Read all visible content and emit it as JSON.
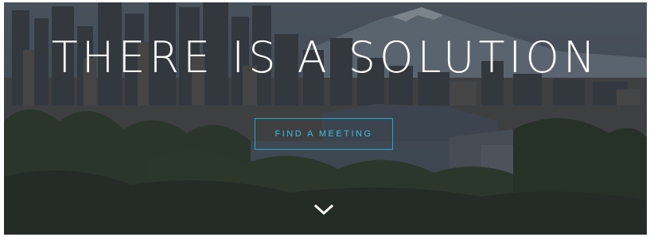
{
  "hero": {
    "headline": "THERE IS A SOLUTION",
    "cta_label": "FIND A MEETING",
    "scroll_icon": "chevron-down-icon",
    "background_image": "seattle-skyline-photo"
  },
  "colors": {
    "accent": "#22a9c9",
    "accent_text": "#3cc0de",
    "headline_text": "#ffffff",
    "overlay": "#141a22"
  }
}
